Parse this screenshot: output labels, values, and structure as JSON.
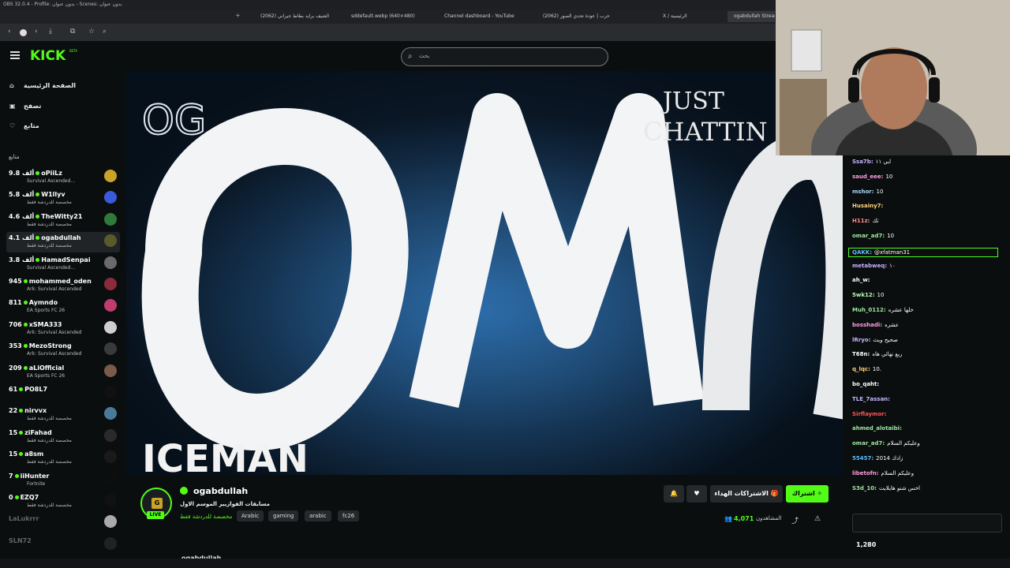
{
  "window": {
    "title": "OBS 32.0.4 - Profile: بدون عنوان - Scenes: بدون عنوان"
  },
  "browser": {
    "tabs": [
      {
        "label": "الشيف برايد بطاط جيراني (2062)"
      },
      {
        "label": "sddefault.webp (640×480)"
      },
      {
        "label": "Channel dashboard - YouTube"
      },
      {
        "label": "حرب | عودة تحدي الصور (2062)"
      },
      {
        "label": "X / الرئيسية"
      },
      {
        "label": "ogabdullah Stream"
      }
    ]
  },
  "site": {
    "logo": "KICK",
    "beta": "BETA",
    "search_placeholder": "بحث"
  },
  "sidebar": {
    "nav": [
      {
        "label": "الصفحة الرئيسية",
        "icon": "home-icon"
      },
      {
        "label": "تصفح",
        "icon": "browse-icon"
      },
      {
        "label": "متابع",
        "icon": "heart-icon"
      }
    ],
    "following_title": "متابع",
    "channels": [
      {
        "count": "9.8 ألف",
        "name": "oPiiLz",
        "category": "Survival Ascended...",
        "avatar_color": "#c9a227",
        "live": true
      },
      {
        "count": "5.8 ألف",
        "name": "W1llyv",
        "category": "مخصصة للدردشة فقط",
        "avatar_color": "#3a5bd9",
        "live": true
      },
      {
        "count": "4.6 ألف",
        "name": "TheWitty21",
        "category": "مخصصة للدردشة فقط",
        "avatar_color": "#2d7a3a",
        "live": true
      },
      {
        "count": "4.1 ألف",
        "name": "ogabdullah",
        "category": "مخصصة للدردشة فقط",
        "avatar_color": "#5a5a2a",
        "live": true
      },
      {
        "count": "3.8 ألف",
        "name": "HamadSenpai",
        "category": "Survival Ascended...",
        "avatar_color": "#6a6a6a",
        "live": true
      },
      {
        "count": "945",
        "name": "mohammed_oden",
        "category": "Ark: Survival Ascended",
        "avatar_color": "#8a2a3a",
        "live": true
      },
      {
        "count": "811",
        "name": "Aymndo",
        "category": "EA Sports FC 26",
        "avatar_color": "#c23b6e",
        "live": true
      },
      {
        "count": "706",
        "name": "xSMA333",
        "category": "Ark: Survival Ascended",
        "avatar_color": "#cfcfcf",
        "live": true
      },
      {
        "count": "353",
        "name": "MezoStrong",
        "category": "Ark: Survival Ascended",
        "avatar_color": "#3a3a3a",
        "live": true
      },
      {
        "count": "209",
        "name": "aLiOfficial",
        "category": "EA Sports FC 26",
        "avatar_color": "#7a5a4a",
        "live": true
      },
      {
        "count": "61",
        "name": "PO8L7",
        "category": "",
        "avatar_color": "#111111",
        "live": true
      },
      {
        "count": "22",
        "name": "nirvvx",
        "category": "مخصصة للدردشة فقط",
        "avatar_color": "#4a7a9a",
        "live": true
      },
      {
        "count": "15",
        "name": "ziFahad",
        "category": "مخصصة للدردشة فقط",
        "avatar_color": "#2a2a2a",
        "live": true
      },
      {
        "count": "15",
        "name": "a8sm",
        "category": "مخصصة للدردشة فقط",
        "avatar_color": "#1a1a1a",
        "live": true
      },
      {
        "count": "7",
        "name": "iiHunter",
        "category": "Fortnite",
        "avatar_color": "#0e0e0e",
        "live": true
      },
      {
        "count": "0",
        "name": "EZQ7",
        "category": "مخصصة للدردشة فقط",
        "avatar_color": "#111111",
        "live": true
      },
      {
        "count": "",
        "name": "LaLukrrr",
        "category": "",
        "avatar_color": "#aaaaaa",
        "live": false
      },
      {
        "count": "",
        "name": "SLN72",
        "category": "",
        "avatar_color": "#222222",
        "live": false
      }
    ]
  },
  "player": {
    "overlay_text_1": "JUST",
    "overlay_text_2": "CHATTIN",
    "overlay_text_3": "ICEMAN",
    "logo_text": "OG"
  },
  "stream": {
    "channel": "ogabdullah",
    "title": "مسابقات الفوازيير الموسم الاول",
    "category": "مخصصة للدردشة فقط",
    "tags": [
      "Arabic",
      "gaming",
      "arabic",
      "fc26"
    ],
    "viewers_label": "المشاهدون",
    "viewers": "4,071",
    "live_badge": "LIVE",
    "subscribe_label": "اشتراك",
    "gift_label": "الاشتراكات الهداء",
    "bottom_name": "ogabdullah"
  },
  "chat": {
    "messages": [
      {
        "user": "Ssa7b:",
        "text": "ابي ١١",
        "color": "#c9b3ff"
      },
      {
        "user": "saud_eee:",
        "text": "10",
        "color": "#ff9de2"
      },
      {
        "user": "mshor:",
        "text": "10",
        "color": "#a6d8ff"
      },
      {
        "user": "Husainy7:",
        "text": "",
        "color": "#ffd27a"
      },
      {
        "user": "H11z:",
        "text": "ثك",
        "color": "#ff8a8a"
      },
      {
        "user": "omar_ad7:",
        "text": "10",
        "color": "#9ee6a0"
      },
      {
        "user": "QAKK:",
        "text": "@xfatman31",
        "color": "#5cc0ff"
      },
      {
        "user": "metabweq:",
        "text": "١٠",
        "color": "#c9b3ff"
      },
      {
        "user": "ah_w:",
        "text": "",
        "color": "#ffffff"
      },
      {
        "user": "5wk12:",
        "text": "10",
        "color": "#b3ffb3"
      },
      {
        "user": "Muh_0112:",
        "text": "خلها عشره",
        "color": "#9ee6a0"
      },
      {
        "user": "bosshadi:",
        "text": "عشره",
        "color": "#ff9de2"
      },
      {
        "user": "lRryo:",
        "text": "صحيح ويث",
        "color": "#c9b3ff"
      },
      {
        "user": "T68n:",
        "text": "ربع نهائي هاه",
        "color": "#ffffff"
      },
      {
        "user": "q_lqc:",
        "text": "10.",
        "color": "#ffd27a"
      },
      {
        "user": "bo_qaht:",
        "text": "",
        "color": "#ffffff"
      },
      {
        "user": "TLE_7assan:",
        "text": "",
        "color": "#c9b3ff"
      },
      {
        "user": "Sirflaymor:",
        "text": "",
        "color": "#ff5555"
      },
      {
        "user": "ahmed_alotaibi:",
        "text": "",
        "color": "#9ee6a0"
      },
      {
        "user": "omar_ad7:",
        "text": "وعليكم السلام",
        "color": "#9ee6a0"
      },
      {
        "user": "55457:",
        "text": "زادك 2014",
        "color": "#5cc0ff"
      },
      {
        "user": "libetofn:",
        "text": "وعليكم السلام",
        "color": "#ff9de2"
      },
      {
        "user": "S3d_10:",
        "text": "اخس شنو هايلايت",
        "color": "#9ee6a0"
      }
    ],
    "viewer_count_bottom": "1,280"
  },
  "colors": {
    "brand": "#53fc18",
    "bg": "#0b0e0f"
  }
}
